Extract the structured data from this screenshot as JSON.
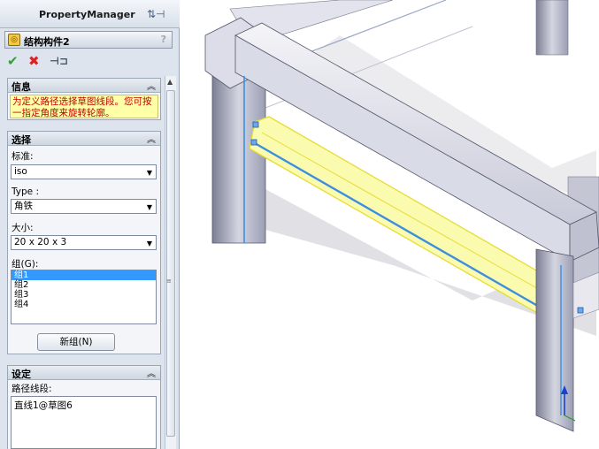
{
  "property_manager": {
    "title": "PropertyManager",
    "feature_name": "结构构件2",
    "help": "?"
  },
  "actions": {
    "ok": "✔",
    "cancel": "✖",
    "pin": "⊣⊐"
  },
  "info": {
    "header": "信息",
    "text": "为定义路径选择草图线段。您可按一指定角度来旋转轮廓。"
  },
  "selection": {
    "header": "选择",
    "standard_label": "标准:",
    "standard_value": "iso",
    "type_label": "Type :",
    "type_value": "角铁",
    "size_label": "大小:",
    "size_value": "20 x 20 x 3",
    "group_label": "组(G):",
    "groups": [
      "组1",
      "组2",
      "组3",
      "组4"
    ],
    "new_group_button": "新组(N)"
  },
  "settings": {
    "header": "设定",
    "path_label": "路径线段:",
    "path_items": [
      "直线1@草图6"
    ]
  },
  "colors": {
    "selection_yellow": "#f2f25a",
    "sketch_blue": "#3c8fe0",
    "frame": "#c9cde0"
  }
}
